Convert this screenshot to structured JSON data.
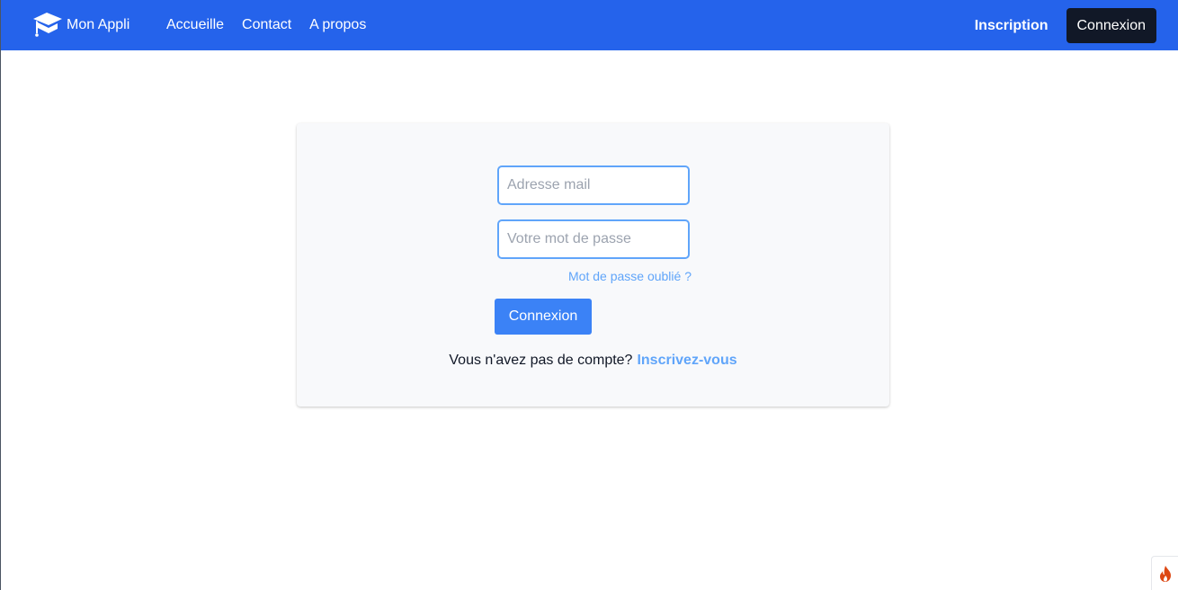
{
  "navbar": {
    "brand_name": "Mon Appli",
    "brand_icon": "graduation-cap-icon",
    "links": [
      "Accueille",
      "Contact",
      "A propos"
    ],
    "signup_label": "Inscription",
    "login_label": "Connexion",
    "background_color": "#2563eb"
  },
  "login_form": {
    "email_placeholder": "Adresse mail",
    "email_value": "",
    "password_placeholder": "Votre mot de passe",
    "password_value": "",
    "forgot_password": "Mot de passe oublié ?",
    "submit_label": "Connexion",
    "no_account_text": "Vous n'avez pas de compte?",
    "signup_cta": "Inscrivez-vous",
    "accent_color": "#3b82f6"
  },
  "debug_toolbar": {
    "icon": "flame-icon"
  }
}
